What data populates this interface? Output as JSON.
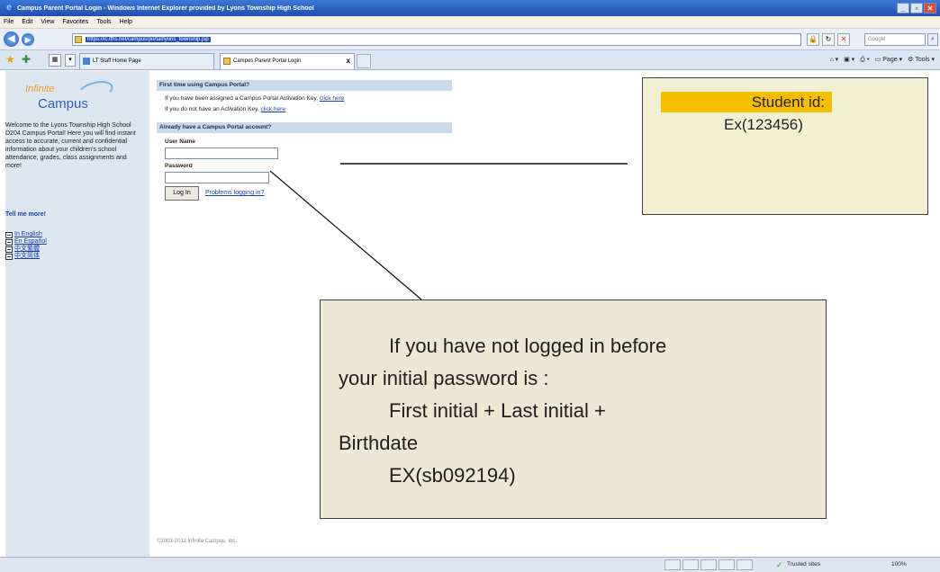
{
  "window": {
    "title": "Campus Parent Portal Login - Windows Internet Explorer provided by Lyons Township High School",
    "minimize": "_",
    "restore": "▫",
    "close": "✕"
  },
  "menu": {
    "items": [
      "File",
      "Edit",
      "View",
      "Favorites",
      "Tools",
      "Help"
    ]
  },
  "address": {
    "url": "https://ic.lths.net/campus/portal/lyons_township.jsp",
    "search_placeholder": "Google"
  },
  "tabs": [
    {
      "label": "LT Staff Home Page"
    },
    {
      "label": "Campus Parent Portal Login",
      "close": "x"
    }
  ],
  "commandbar": {
    "page_label": "Page",
    "tools_label": "Tools"
  },
  "sidebar": {
    "logo_top": "Infinite",
    "logo_bottom": "Campus",
    "welcome": "Welcome to the Lyons Township High School D204 Campus Portal! Here you will find instant access to accurate, current and confidential information about your children's school attendance, grades, class assignments and more!",
    "tell_more": "Tell me more!",
    "languages": [
      "In English",
      "En Español",
      "中文繁體",
      "中文简体"
    ]
  },
  "main": {
    "first_time_header": "First time using Campus Portal?",
    "activation_line_1": "If you have been assigned a Campus Portal Activation Key,",
    "activation_link_1": "click here",
    "activation_line_2": "If you do not have an Activation Key,",
    "activation_link_2": "click here",
    "account_header": "Already have a Campus Portal account?",
    "username_label": "User Name",
    "password_label": "Password",
    "login_button": "Log In",
    "problems_link": "Problems logging in?",
    "copyright": "©2003-2011 Infinite Campus, Inc."
  },
  "annotations": {
    "student_id_label": "Student id:",
    "student_id_example": "Ex(123456)",
    "password_lines": [
      "If you have not logged in before",
      "your initial password is :",
      "First initial  + Last initial +",
      "Birthdate",
      "EX(sb092194)"
    ]
  },
  "statusbar": {
    "zone": "Trusted sites",
    "zoom": "100%"
  }
}
